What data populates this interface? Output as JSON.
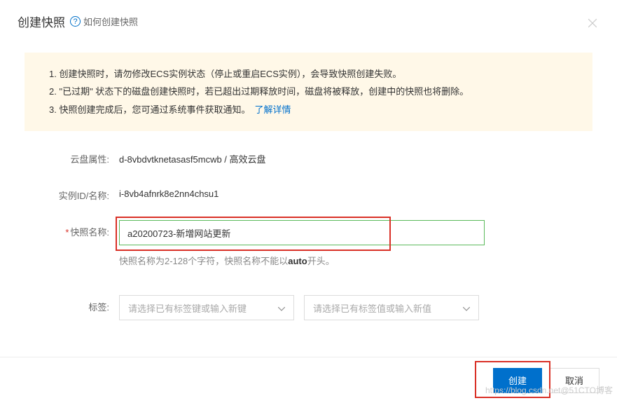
{
  "header": {
    "title": "创建快照",
    "help_text": "如何创建快照"
  },
  "info": {
    "items": [
      "创建快照时，请勿修改ECS实例状态（停止或重启ECS实例），会导致快照创建失败。",
      "\"已过期\" 状态下的磁盘创建快照时，若已超出过期释放时间，磁盘将被释放，创建中的快照也将删除。",
      "快照创建完成后，您可通过系统事件获取通知。"
    ],
    "link": "了解详情"
  },
  "form": {
    "disk_label": "云盘属性:",
    "disk_value": "d-8vbdvtknetasasf5mcwb / 高效云盘",
    "instance_label": "实例ID/名称:",
    "instance_value": "i-8vb4afnrk8e2nn4chsu1",
    "snapshot_name_label": "快照名称:",
    "snapshot_name_value": "a20200723-新增网站更新",
    "snapshot_hint_prefix": "快照名称为2-128个字符，快照名称不能以",
    "snapshot_hint_bold": "auto",
    "snapshot_hint_suffix": "开头。",
    "tag_label": "标签:",
    "tag_key_placeholder": "请选择已有标签键或输入新键",
    "tag_value_placeholder": "请选择已有标签值或输入新值"
  },
  "footer": {
    "create": "创建",
    "cancel": "取消"
  },
  "watermark": "https://blog.csdn.net@51CTO博客"
}
